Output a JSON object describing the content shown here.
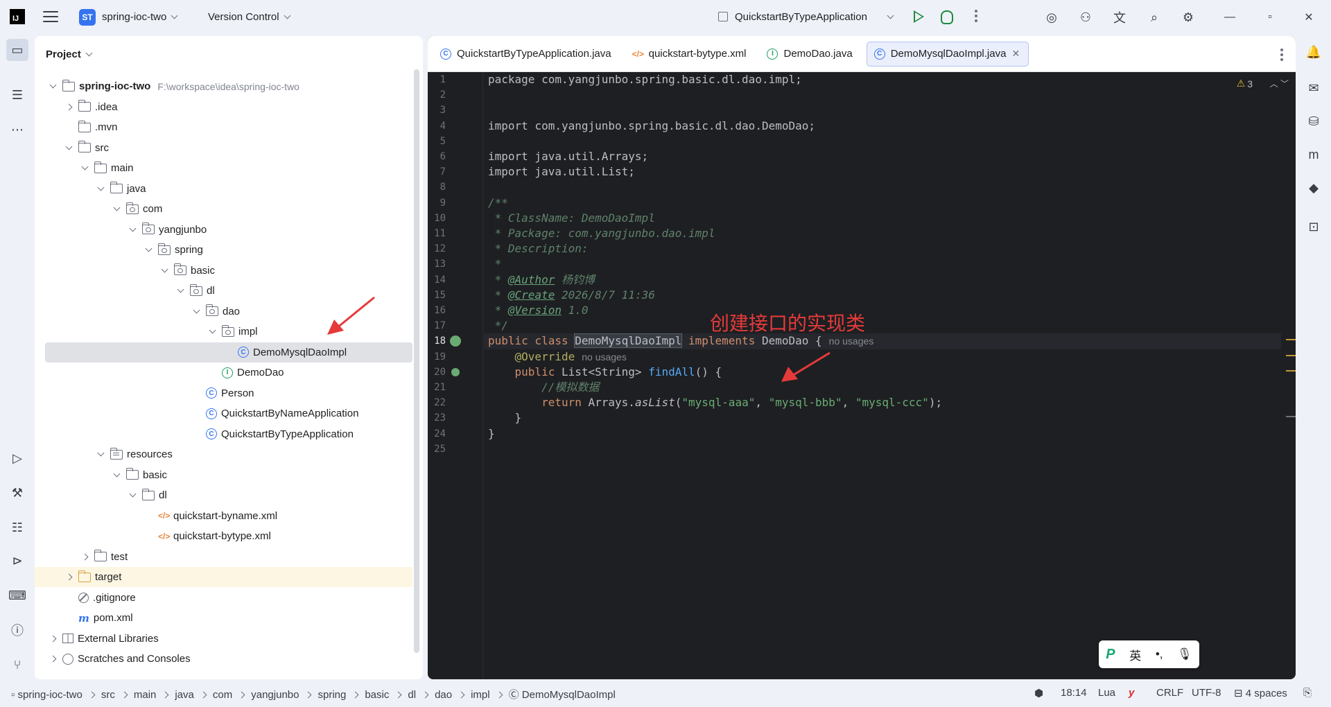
{
  "titlebar": {
    "logo": "IJ",
    "project_badge": "ST",
    "project_name": "spring-ioc-two",
    "vcs": "Version Control",
    "run_config": "QuickstartByTypeApplication"
  },
  "project_panel": {
    "title": "Project",
    "tree": [
      {
        "label": "spring-ioc-two",
        "path": "F:\\workspace\\idea\\spring-ioc-two",
        "depth": 0,
        "arrow": "down",
        "icon": "folder",
        "bold": true
      },
      {
        "label": ".idea",
        "depth": 1,
        "arrow": "right",
        "icon": "folder"
      },
      {
        "label": ".mvn",
        "depth": 1,
        "arrow": "none",
        "icon": "folder"
      },
      {
        "label": "src",
        "depth": 1,
        "arrow": "down",
        "icon": "folder"
      },
      {
        "label": "main",
        "depth": 2,
        "arrow": "down",
        "icon": "folder"
      },
      {
        "label": "java",
        "depth": 3,
        "arrow": "down",
        "icon": "folder"
      },
      {
        "label": "com",
        "depth": 4,
        "arrow": "down",
        "icon": "package"
      },
      {
        "label": "yangjunbo",
        "depth": 5,
        "arrow": "down",
        "icon": "package"
      },
      {
        "label": "spring",
        "depth": 6,
        "arrow": "down",
        "icon": "package"
      },
      {
        "label": "basic",
        "depth": 7,
        "arrow": "down",
        "icon": "package"
      },
      {
        "label": "dl",
        "depth": 8,
        "arrow": "down",
        "icon": "package"
      },
      {
        "label": "dao",
        "depth": 9,
        "arrow": "down",
        "icon": "package"
      },
      {
        "label": "impl",
        "depth": 10,
        "arrow": "down",
        "icon": "package"
      },
      {
        "label": "DemoMysqlDaoImpl",
        "depth": 11,
        "arrow": "none",
        "icon": "class",
        "selected": true
      },
      {
        "label": "DemoDao",
        "depth": 10,
        "arrow": "none",
        "icon": "interface"
      },
      {
        "label": "Person",
        "depth": 9,
        "arrow": "none",
        "icon": "class"
      },
      {
        "label": "QuickstartByNameApplication",
        "depth": 9,
        "arrow": "none",
        "icon": "app-class"
      },
      {
        "label": "QuickstartByTypeApplication",
        "depth": 9,
        "arrow": "none",
        "icon": "app-class"
      },
      {
        "label": "resources",
        "depth": 3,
        "arrow": "down",
        "icon": "resources"
      },
      {
        "label": "basic",
        "depth": 4,
        "arrow": "down",
        "icon": "folder"
      },
      {
        "label": "dl",
        "depth": 5,
        "arrow": "down",
        "icon": "folder"
      },
      {
        "label": "quickstart-byname.xml",
        "depth": 6,
        "arrow": "none",
        "icon": "xml"
      },
      {
        "label": "quickstart-bytype.xml",
        "depth": 6,
        "arrow": "none",
        "icon": "xml"
      },
      {
        "label": "test",
        "depth": 2,
        "arrow": "right",
        "icon": "folder"
      },
      {
        "label": "target",
        "depth": 1,
        "arrow": "right",
        "icon": "folder-orange",
        "highlight": true
      },
      {
        "label": ".gitignore",
        "depth": 1,
        "arrow": "none",
        "icon": "gitignore"
      },
      {
        "label": "pom.xml",
        "depth": 1,
        "arrow": "none",
        "icon": "maven"
      },
      {
        "label": "External Libraries",
        "depth": 0,
        "arrow": "right",
        "icon": "library"
      },
      {
        "label": "Scratches and Consoles",
        "depth": 0,
        "arrow": "right",
        "icon": "scratch"
      }
    ]
  },
  "editor": {
    "tabs": [
      {
        "label": "QuickstartByTypeApplication.java",
        "icon": "app-class",
        "active": false
      },
      {
        "label": "quickstart-bytype.xml",
        "icon": "xml",
        "active": false
      },
      {
        "label": "DemoDao.java",
        "icon": "interface",
        "active": false
      },
      {
        "label": "DemoMysqlDaoImpl.java",
        "icon": "class",
        "active": true
      }
    ],
    "warnings_count": "3",
    "current_line": 18,
    "lines": [
      [
        {
          "t": "package com.yangjunbo.spring.basic.dl.dao.impl;",
          "c": ""
        }
      ],
      [],
      [],
      [
        {
          "t": "import com.yangjunbo.spring.basic.dl.dao.DemoDao;",
          "c": ""
        }
      ],
      [],
      [
        {
          "t": "import java.util.Arrays;",
          "c": ""
        }
      ],
      [
        {
          "t": "import java.util.List;",
          "c": ""
        }
      ],
      [],
      [
        {
          "t": "/**",
          "c": "cm"
        }
      ],
      [
        {
          "t": " * ClassName: DemoDaoImpl",
          "c": "cm"
        }
      ],
      [
        {
          "t": " * Package: com.yangjunbo.dao.impl",
          "c": "cm"
        }
      ],
      [
        {
          "t": " * Description:",
          "c": "cm"
        }
      ],
      [
        {
          "t": " *",
          "c": "cm"
        }
      ],
      [
        {
          "t": " * ",
          "c": "cm"
        },
        {
          "t": "@Author",
          "c": "cm-tag"
        },
        {
          "t": " 杨钧博",
          "c": "cm-tag2"
        }
      ],
      [
        {
          "t": " * ",
          "c": "cm"
        },
        {
          "t": "@Create",
          "c": "cm-tag"
        },
        {
          "t": " 2026/8/7 11:36",
          "c": "cm-tag2"
        }
      ],
      [
        {
          "t": " * ",
          "c": "cm"
        },
        {
          "t": "@Version",
          "c": "cm-tag"
        },
        {
          "t": " 1.0",
          "c": "cm-tag2"
        }
      ],
      [
        {
          "t": " */",
          "c": "cm"
        }
      ],
      [
        {
          "t": "public class ",
          "c": "kw"
        },
        {
          "t": "DemoMysqlDaoImpl",
          "c": "hl"
        },
        {
          "t": " implements ",
          "c": "kw"
        },
        {
          "t": "DemoDao {",
          "c": ""
        },
        {
          "t": "no usages",
          "c": "hint"
        }
      ],
      [
        {
          "t": "    ",
          "c": ""
        },
        {
          "t": "@Override",
          "c": "ann"
        },
        {
          "t": "no usages",
          "c": "hint"
        }
      ],
      [
        {
          "t": "    ",
          "c": ""
        },
        {
          "t": "public ",
          "c": "kw"
        },
        {
          "t": "List<String> ",
          "c": ""
        },
        {
          "t": "findAll",
          "c": "fn"
        },
        {
          "t": "() {",
          "c": ""
        }
      ],
      [
        {
          "t": "        ",
          "c": ""
        },
        {
          "t": "//模拟数据",
          "c": "cm"
        }
      ],
      [
        {
          "t": "        ",
          "c": ""
        },
        {
          "t": "return ",
          "c": "kw"
        },
        {
          "t": "Arrays.",
          "c": ""
        },
        {
          "t": "asList",
          "c": "italic"
        },
        {
          "t": "(",
          "c": ""
        },
        {
          "t": "\"mysql-aaa\"",
          "c": "str"
        },
        {
          "t": ", ",
          "c": ""
        },
        {
          "t": "\"mysql-bbb\"",
          "c": "str"
        },
        {
          "t": ", ",
          "c": ""
        },
        {
          "t": "\"mysql-ccc\"",
          "c": "str"
        },
        {
          "t": ");",
          "c": ""
        }
      ],
      [
        {
          "t": "    }",
          "c": ""
        }
      ],
      [
        {
          "t": "}",
          "c": ""
        }
      ],
      []
    ]
  },
  "annotation": "创建接口的实现类",
  "ime": {
    "mode": "英",
    "punct": "•,",
    "mic": "🎙"
  },
  "statusbar": {
    "breadcrumbs": [
      "spring-ioc-two",
      "src",
      "main",
      "java",
      "com",
      "yangjunbo",
      "spring",
      "basic",
      "dl",
      "dao",
      "impl",
      "DemoMysqlDaoImpl"
    ],
    "position": "18:14",
    "language": "Lua",
    "line_sep": "CRLF",
    "encoding": "UTF-8",
    "indent": "4 spaces"
  }
}
